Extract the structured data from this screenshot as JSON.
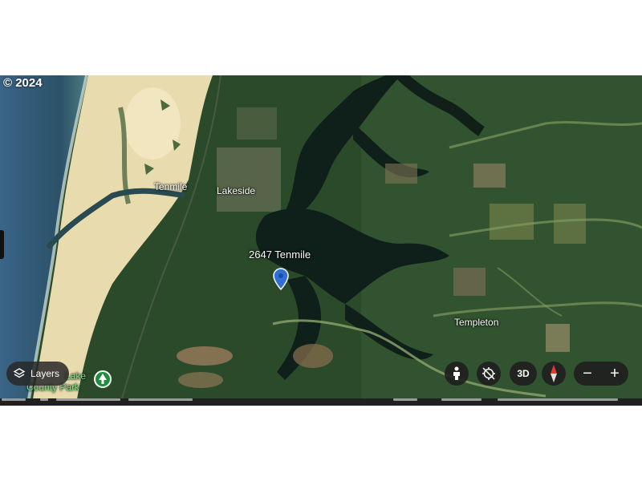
{
  "map": {
    "copyright": "© 2024",
    "labels": {
      "tenmile": "Tenmile",
      "lakeside": "Lakeside",
      "address": "2647 Tenmile",
      "templeton": "Templeton",
      "park_line1": "Lake",
      "park_line2": "County Park"
    },
    "icons": {
      "location_pin": "location-pin-icon",
      "park": "tree-icon"
    }
  },
  "controls": {
    "layers_label": "Layers",
    "three_d_label": "3D",
    "zoom_out": "−",
    "zoom_in": "+"
  },
  "colors": {
    "forest": "#2c4a2a",
    "water": "#0f1e1a",
    "sand": "#e9dcae",
    "ocean": "#2e5672",
    "pin": "#2f6fd6",
    "park_pin": "#1e8e3e"
  }
}
